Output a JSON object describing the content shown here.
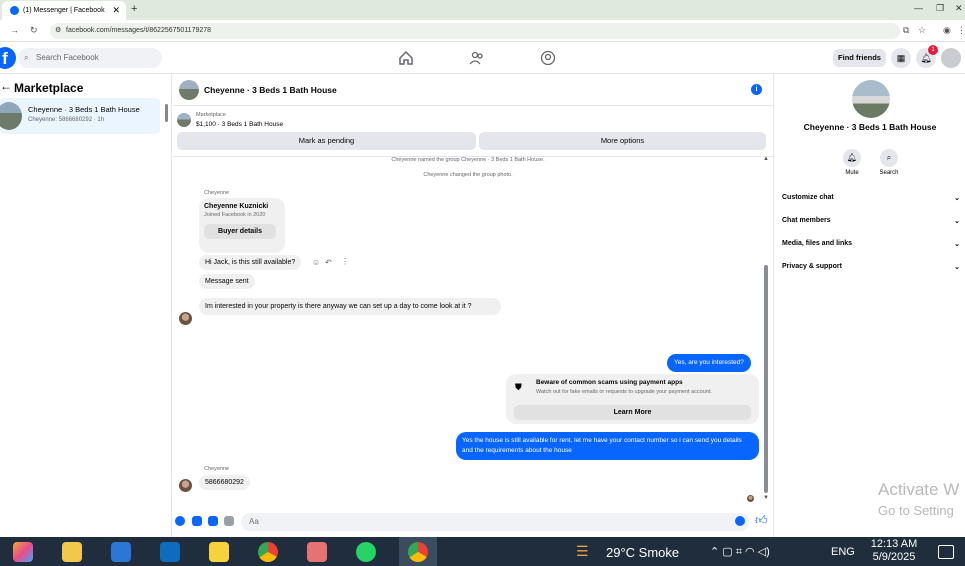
{
  "browser": {
    "tab_title": "(1) Messenger | Facebook",
    "url": "facebook.com/messages/t/8622567501179278"
  },
  "fb": {
    "search_placeholder": "Search Facebook",
    "find_friends": "Find friends",
    "notif_count": "1"
  },
  "sidebar": {
    "title": "Marketplace",
    "item_name": "Cheyenne · 3 Beds 1 Bath House",
    "item_sub": "Cheyenne: 5866680292 · 1h"
  },
  "chat": {
    "title": "Cheyenne · 3 Beds 1 Bath House",
    "listing_label": "Marketplace",
    "listing_price": "$1,100 · 3 Beds 1 Bath House",
    "mark_pending": "Mark as pending",
    "more_options": "More options",
    "system_msgs": [
      "Cheyenne named the group Cheyenne · 3 Beds 1 Bath House.",
      "Cheyenne changed the group photo."
    ],
    "sender_name": "Cheyenne",
    "profile_card": {
      "name": "Cheyenne Kuznicki",
      "joined": "Joined Facebook in 2020",
      "button": "Buyer details"
    },
    "msg1": "Hi Jack, is this still available?",
    "msg2": "Message sent",
    "msg3": "Im interested in your property is there anyway we can set up a day to come look at it ?",
    "out1": "Yes, are you interested?",
    "scam": {
      "title": "Beware of common scams using payment apps",
      "body": "Watch out for fake emails or requests to upgrade your payment account.",
      "button": "Learn More"
    },
    "out2": "Yes the house is still available for rent, let me have your contact number so i can send you details and the requirements about the house",
    "sender_name2": "Cheyenne",
    "msg4": "5866680292",
    "input_placeholder": "Aa"
  },
  "right_panel": {
    "title": "Cheyenne · 3 Beds 1 Bath House",
    "mute": "Mute",
    "search": "Search",
    "rows": [
      "Customize chat",
      "Chat members",
      "Media, files and links",
      "Privacy & support"
    ]
  },
  "watermark": {
    "line1": "Activate W",
    "line2": "Go to Setting"
  },
  "taskbar": {
    "weather": "29°C  Smoke",
    "lang": "ENG",
    "time": "12:13 AM",
    "date": "5/9/2025"
  }
}
